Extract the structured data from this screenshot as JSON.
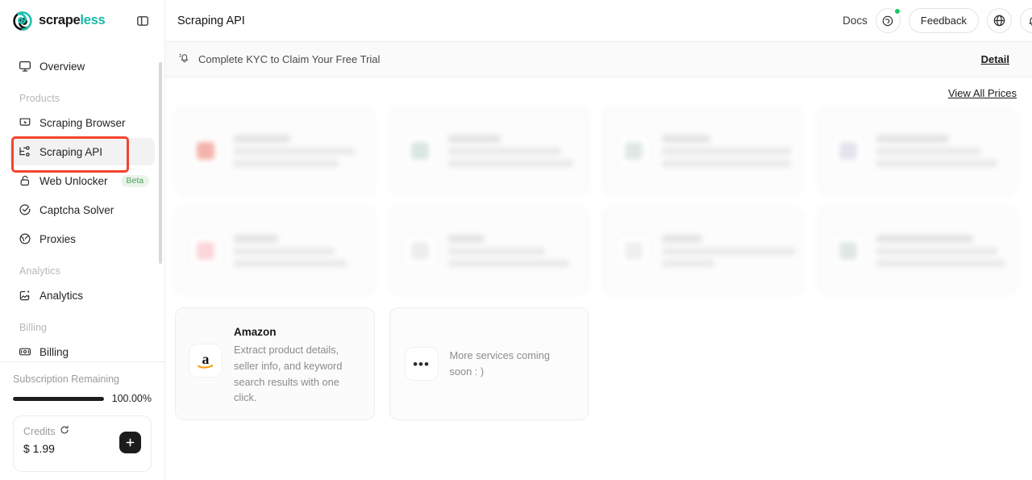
{
  "brand": {
    "name_part1": "scrape",
    "name_part2": "less",
    "logo_icon": "scrapeless-spiral-logo",
    "panel_toggle_icon": "panel-collapse-icon"
  },
  "sidebar": {
    "overview": {
      "label": "Overview",
      "icon": "monitor-icon"
    },
    "sections": [
      {
        "label": "Products",
        "items": [
          {
            "label": "Scraping Browser",
            "icon": "browser-cursor-icon",
            "active": false,
            "badge": ""
          },
          {
            "label": "Scraping API",
            "icon": "api-node-icon",
            "active": true,
            "badge": ""
          },
          {
            "label": "Web Unlocker",
            "icon": "unlock-icon",
            "active": false,
            "badge": "Beta"
          },
          {
            "label": "Captcha Solver",
            "icon": "check-circle-icon",
            "active": false,
            "badge": ""
          },
          {
            "label": "Proxies",
            "icon": "globe-proxy-icon",
            "active": false,
            "badge": ""
          }
        ]
      },
      {
        "label": "Analytics",
        "items": [
          {
            "label": "Analytics",
            "icon": "chart-image-icon",
            "active": false,
            "badge": ""
          }
        ]
      },
      {
        "label": "Billing",
        "items": [
          {
            "label": "Billing",
            "icon": "banknote-icon",
            "active": false,
            "badge": ""
          }
        ]
      }
    ],
    "footer": {
      "subscription_label": "Subscription Remaining",
      "subscription_percent_text": "100.00%",
      "subscription_percent_value": 100,
      "credits_label": "Credits",
      "credits_refresh_icon": "refresh-icon",
      "credits_amount": "$ 1.99",
      "add_credits_icon": "plus-icon"
    }
  },
  "topbar": {
    "page_title": "Scraping API",
    "docs_label": "Docs",
    "support_icon": "headset-support-icon",
    "support_has_badge": true,
    "feedback_label": "Feedback",
    "language_icon": "globe-icon",
    "notifications_icon": "bell-icon"
  },
  "kyc_banner": {
    "icon": "bell-ring-icon",
    "message": "Complete KYC to Claim Your Free Trial",
    "action_label": "Detail"
  },
  "content": {
    "view_all_prices_label": "View All Prices",
    "skeleton_cards": [
      {
        "id": "sk1",
        "icon_tint": "#f3b2aa",
        "lines": [
          70,
          150,
          130
        ]
      },
      {
        "id": "sk2",
        "icon_tint": "#d9e6e2",
        "lines": [
          65,
          140,
          155
        ]
      },
      {
        "id": "sk3",
        "icon_tint": "#dfe8e5",
        "lines": [
          60,
          160,
          160
        ]
      },
      {
        "id": "sk4",
        "icon_tint": "#e6e2ee",
        "lines": [
          90,
          130,
          150
        ]
      },
      {
        "id": "sk5",
        "icon_tint": "#fbd5d9",
        "lines": [
          55,
          125,
          140
        ]
      },
      {
        "id": "sk6",
        "icon_tint": "#ededed",
        "lines": [
          45,
          120,
          150
        ]
      },
      {
        "id": "sk7",
        "icon_tint": "#efefef",
        "lines": [
          50,
          165,
          65
        ]
      },
      {
        "id": "sk8",
        "icon_tint": "#dfe7e4",
        "lines": [
          120,
          150,
          160
        ]
      }
    ],
    "amazon_card": {
      "name": "Amazon",
      "description": "Extract product details, seller info, and keyword search results with one click.",
      "icon": "amazon-logo-icon",
      "highlighted": true
    },
    "more_card": {
      "icon": "ellipsis-icon",
      "text": "More services coming soon : )"
    }
  },
  "colors": {
    "accent_teal": "#19b7a6",
    "highlight_red": "#f4442e",
    "beta_green_text": "#4ca05a",
    "beta_green_bg": "#eaf5ea",
    "status_green": "#17c964",
    "amazon_orange": "#ff9900"
  }
}
